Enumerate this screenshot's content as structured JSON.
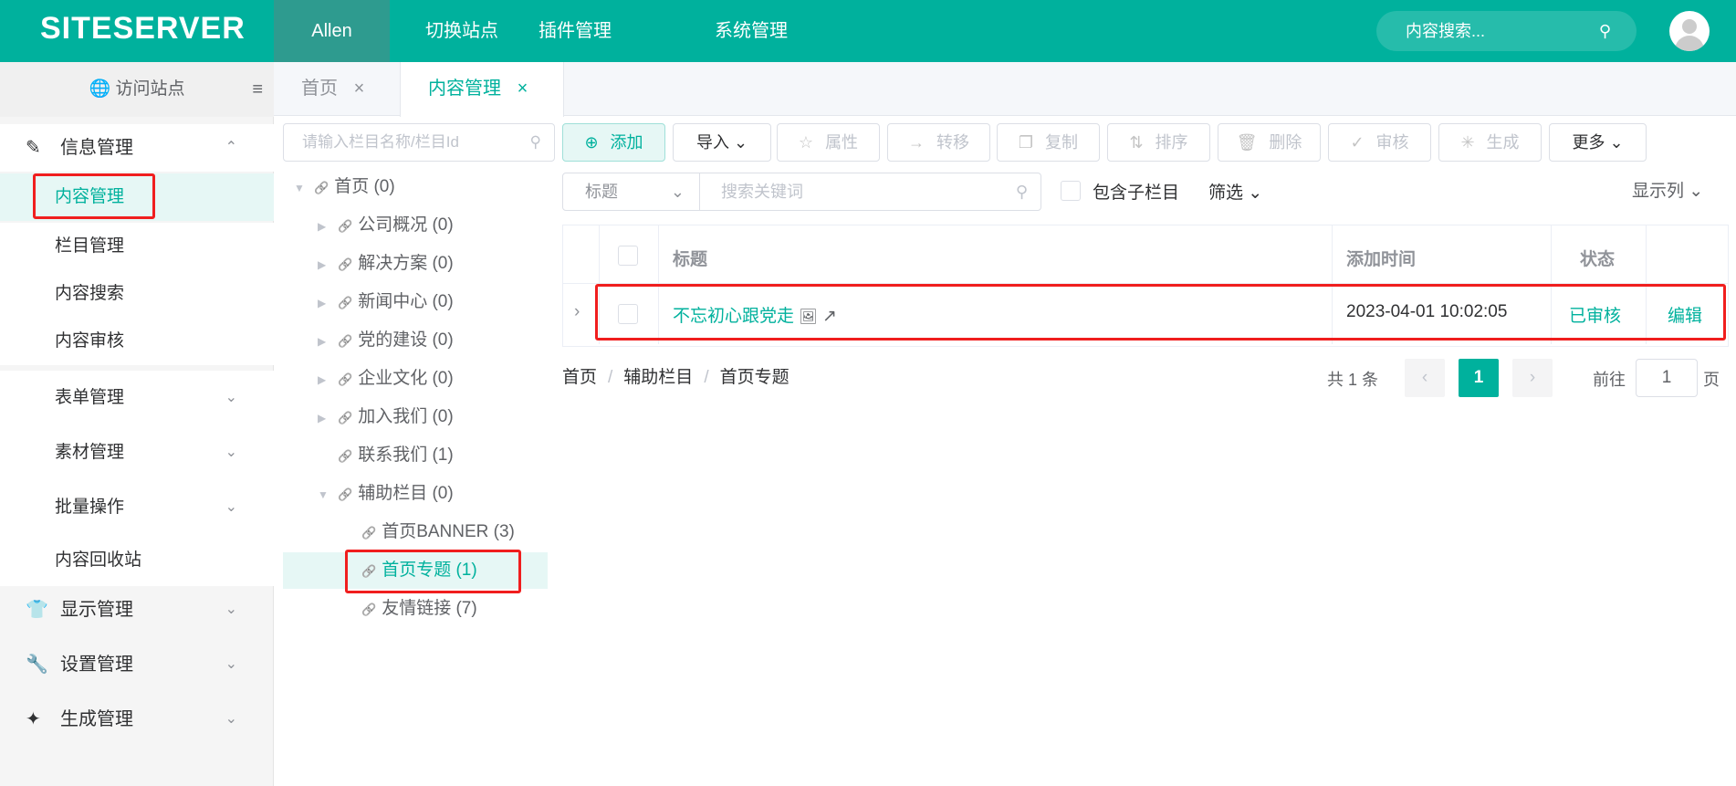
{
  "header": {
    "logo": "SITESERVER",
    "nav": [
      "Allen",
      "切换站点",
      "插件管理",
      "系统管理"
    ],
    "search_placeholder": "内容搜索..."
  },
  "sidebar": {
    "visit": "访问站点",
    "groups": [
      {
        "label": "信息管理",
        "items": [
          "内容管理",
          "栏目管理",
          "内容搜索",
          "内容审核"
        ]
      },
      {
        "label": "表单管理"
      },
      {
        "label": "素材管理"
      },
      {
        "label": "批量操作"
      },
      {
        "label": "内容回收站"
      },
      {
        "label": "显示管理"
      },
      {
        "label": "设置管理"
      },
      {
        "label": "生成管理"
      }
    ]
  },
  "tabs": [
    {
      "label": "首页"
    },
    {
      "label": "内容管理"
    }
  ],
  "tree": {
    "search_placeholder": "请输入栏目名称/栏目Id",
    "nodes": [
      "首页 (0)",
      "公司概况 (0)",
      "解决方案 (0)",
      "新闻中心 (0)",
      "党的建设 (0)",
      "企业文化 (0)",
      "加入我们 (0)",
      "联系我们 (1)",
      "辅助栏目 (0)",
      "首页BANNER (3)",
      "首页专题 (1)",
      "友情链接 (7)"
    ]
  },
  "toolbar": {
    "buttons": [
      "添加",
      "导入",
      "属性",
      "转移",
      "复制",
      "排序",
      "删除",
      "审核",
      "生成",
      "更多"
    ]
  },
  "filter": {
    "field": "标题",
    "keyword_placeholder": "搜索关键词",
    "include_children": "包含子栏目",
    "filter": "筛选",
    "columns": "显示列"
  },
  "table": {
    "headers": [
      "标题",
      "添加时间",
      "状态"
    ],
    "rows": [
      {
        "title": "不忘初心跟党走",
        "time": "2023-04-01 10:02:05",
        "status": "已审核",
        "action": "编辑"
      }
    ]
  },
  "breadcrumb": [
    "首页",
    "辅助栏目",
    "首页专题"
  ],
  "pagination": {
    "total": "共 1 条",
    "page": "1",
    "goto": "前往",
    "goto_value": "1",
    "page_suffix": "页"
  }
}
